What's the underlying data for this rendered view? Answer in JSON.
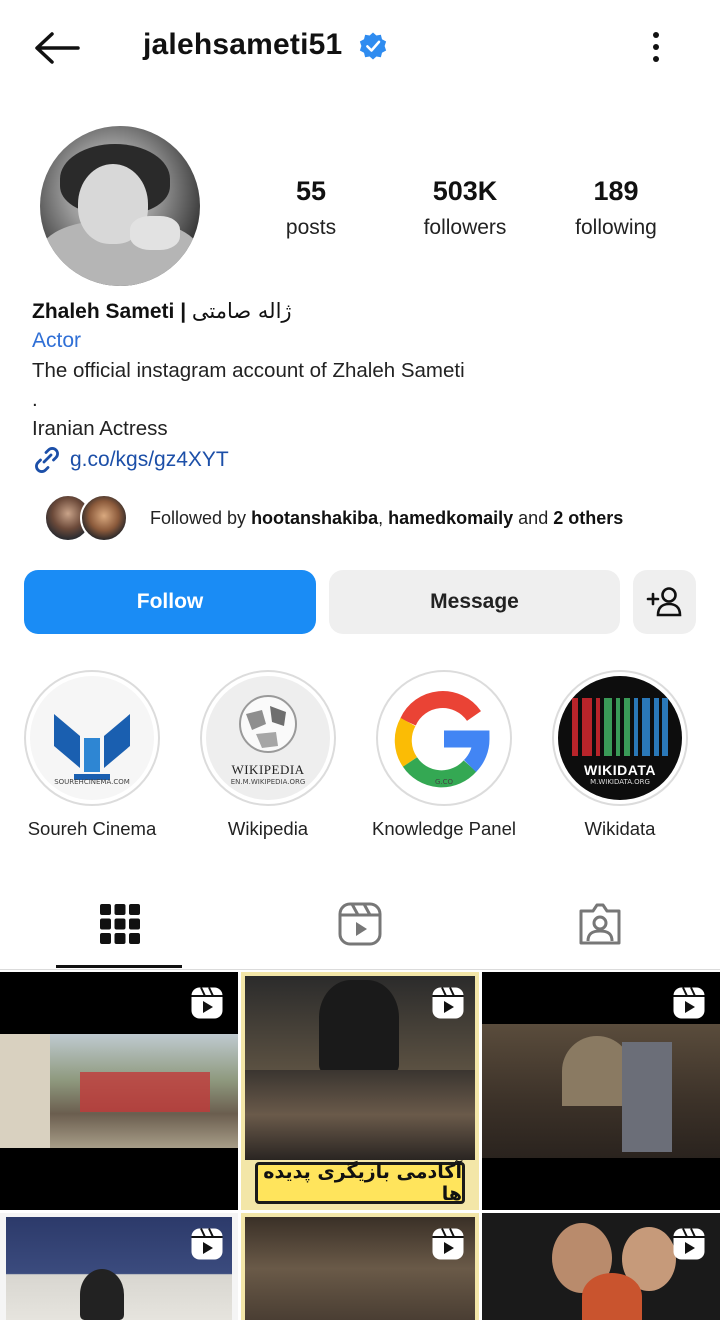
{
  "header": {
    "username": "jalehsameti51"
  },
  "stats": [
    {
      "value": "55",
      "label": "posts"
    },
    {
      "value": "503K",
      "label": "followers"
    },
    {
      "value": "189",
      "label": "following"
    }
  ],
  "bio": {
    "name": "Zhaleh Sameti | ",
    "name_fa": "ژاله صامتی",
    "category": "Actor",
    "lines": [
      "The official instagram account of Zhaleh Sameti",
      ".",
      "Iranian Actress"
    ],
    "link": "g.co/kgs/gz4XYT"
  },
  "followed_by": {
    "prefix": "Followed by ",
    "user1": "hootanshakiba",
    "sep": ", ",
    "user2": "hamedkomaily",
    "mid": " and ",
    "others": "2 others"
  },
  "actions": {
    "follow": "Follow",
    "message": "Message"
  },
  "highlights": [
    {
      "label": "Soureh Cinema",
      "caption": "SOUREHCINEMA.COM"
    },
    {
      "label": "Wikipedia",
      "caption": "EN.M.WIKIPEDIA.ORG",
      "logo_text": "WIKIPEDIA"
    },
    {
      "label": "Knowledge Panel",
      "caption": "G.CO"
    },
    {
      "label": "Wikidata",
      "caption": "M.WIKIDATA.ORG",
      "logo_text": "WIKIDATA"
    }
  ],
  "posts": {
    "banner_text": "آکادمی بازیگری پدیده ها"
  },
  "colors": {
    "accent": "#1a8cf5",
    "link": "#1c4fa8",
    "category": "#2f6fd6",
    "verified": "#2f8cf0"
  }
}
